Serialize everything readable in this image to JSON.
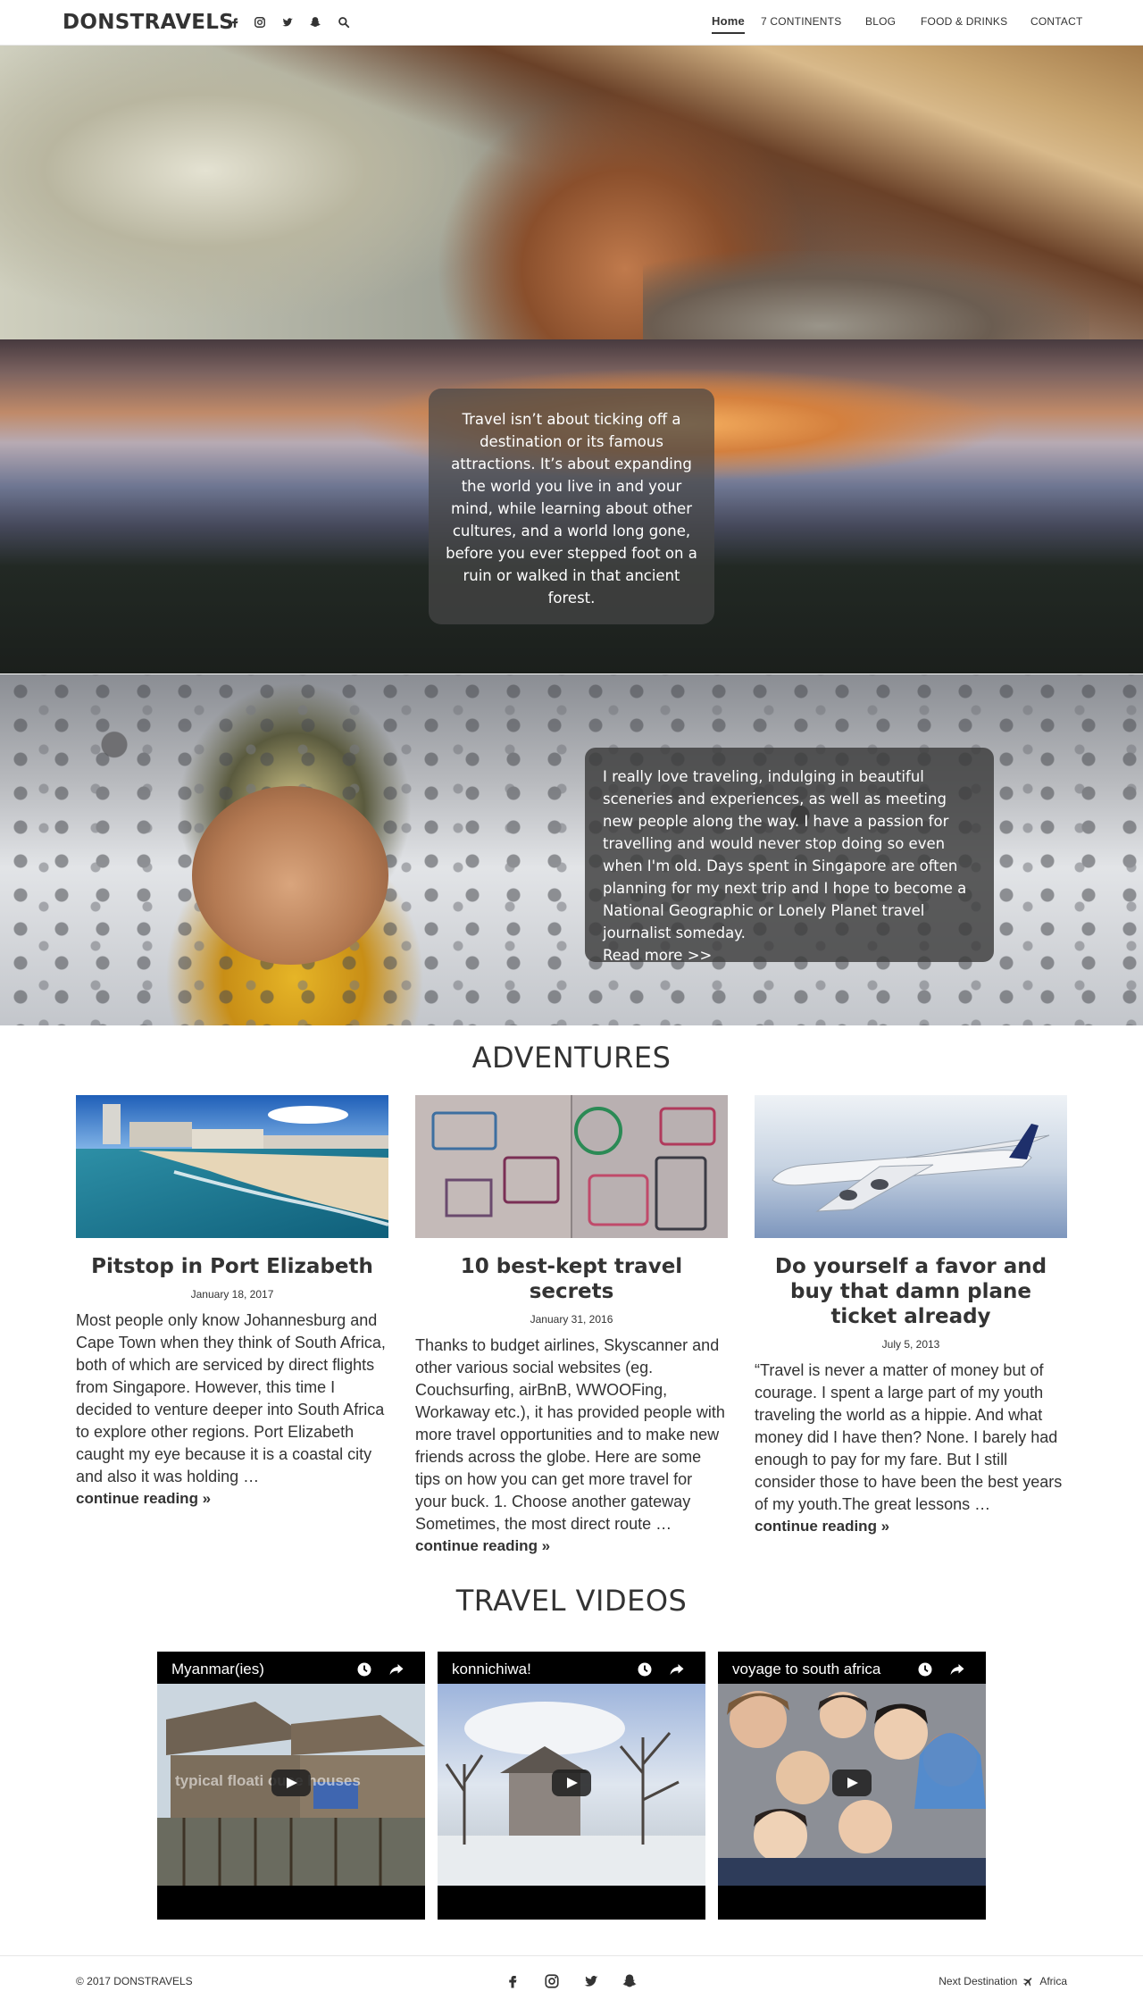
{
  "nav": {
    "brand": "DONSTRAVELS",
    "social_icons": [
      "facebook-icon",
      "instagram-icon",
      "twitter-icon",
      "snapchat-icon",
      "search-icon"
    ],
    "links": [
      "Home",
      "7 CONTINENTS",
      "BLOG",
      "FOOD & DRINKS",
      "CONTACT"
    ]
  },
  "hero": {
    "slides": 3,
    "active_slide": 2
  },
  "quote": {
    "text": "Travel isn’t about ticking off a destination or its famous attractions. It’s about expanding the world you live in and your mind, while learning about other cultures, and a world long gone, before you ever stepped foot on a ruin or walked in that ancient forest."
  },
  "about": {
    "text": "I really love traveling, indulging in beautiful sceneries and experiences, as well as meeting new people along the way. I have a passion for travelling and would never stop doing so even when I'm old. Days spent in Singapore are often planning for my next trip and I hope to become a National Geographic or Lonely Planet travel journalist someday.",
    "more": "Read more >>"
  },
  "adventures": {
    "heading": "ADVENTURES",
    "posts": [
      {
        "title": "Pitstop in Port Elizabeth",
        "date": "January 18, 2017",
        "excerpt": "Most people only know Johannesburg and Cape Town when they think of South Africa, both of which are serviced by direct flights from Singapore. However, this time I decided to venture deeper into South Africa to explore other regions. Port Elizabeth caught my eye because it is a coastal city and also it was holding …",
        "more": "continue reading »"
      },
      {
        "title": "10 best-kept travel secrets",
        "date": "January 31, 2016",
        "excerpt": "Thanks to budget airlines, Skyscanner and other various social websites (eg. Couchsurfing, airBnB, WWOOFing, Workaway etc.), it has provided people with more travel opportunities and to make new friends across the globe. Here are some tips on how you can get more travel for your buck. 1. Choose another gateway Sometimes, the most direct route …",
        "more": "continue reading »"
      },
      {
        "title": "Do yourself a favor and buy that damn plane ticket already",
        "date": "July 5, 2013",
        "excerpt": "“Travel is never a matter of money but of courage.  I spent a large part of my youth traveling the world as a hippie. And what money did I have then? None. I barely had enough to pay for my fare. But I still consider those to have been the best years of my youth.The great lessons …",
        "more": "continue reading »"
      }
    ]
  },
  "videos": {
    "heading": "TRAVEL VIDEOS",
    "items": [
      {
        "title": "Myanmar(ies)",
        "caption": "typical floati   ouse houses"
      },
      {
        "title": "konnichiwa!",
        "caption": ""
      },
      {
        "title": "voyage to south africa",
        "caption": ""
      }
    ]
  },
  "footer": {
    "copyright": "© 2017 DONSTRAVELS",
    "next_label": "Next Destination",
    "next_value": "Africa"
  }
}
